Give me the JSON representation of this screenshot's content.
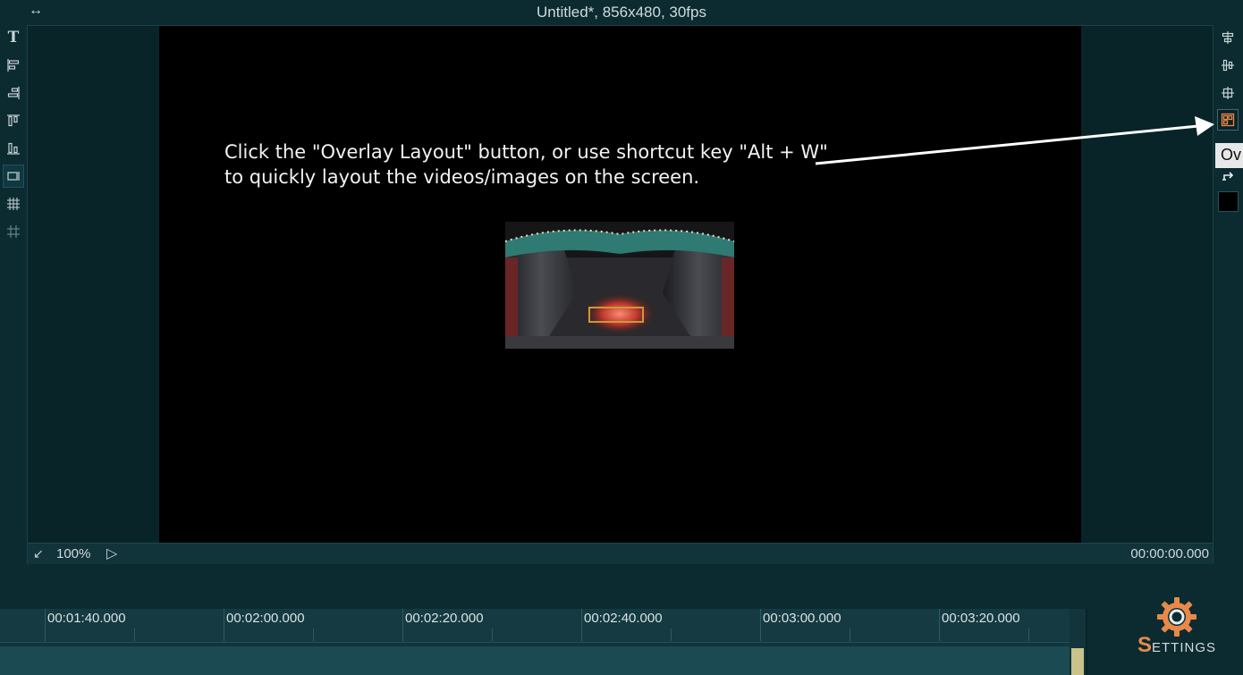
{
  "window": {
    "title": "Untitled*, 856x480, 30fps",
    "swap_icon": "↔"
  },
  "left_toolbar": [
    {
      "name": "text-tool",
      "icon": "T"
    },
    {
      "name": "align-left",
      "icon": "align-left-icon"
    },
    {
      "name": "align-right",
      "icon": "align-right-icon"
    },
    {
      "name": "align-top",
      "icon": "align-top-icon"
    },
    {
      "name": "align-bottom",
      "icon": "align-bottom-icon"
    },
    {
      "name": "safe-frame",
      "icon": "frame-icon"
    },
    {
      "name": "grid-dense",
      "icon": "grid-icon"
    },
    {
      "name": "grid",
      "icon": "hash-icon"
    }
  ],
  "preview": {
    "hint_line1": "Click the \"Overlay Layout\" button, or use shortcut key \"Alt + W\"",
    "hint_line2": "to quickly layout the videos/images on the screen.",
    "zoom": "100%",
    "timecode": "00:00:00.000",
    "shrink_icon": "↙",
    "play_icon": "▷",
    "overlay_image": "stage-curtain-thumbnail"
  },
  "right_toolbar": {
    "tooltip": "Ov",
    "active_tool": "overlay-layout",
    "active_color": "#e8894a",
    "swatch_color": "#000000"
  },
  "timeline": {
    "labels": [
      "00:01:40.000",
      "00:02:00.000",
      "00:02:20.000",
      "00:02:40.000",
      "00:03:00.000",
      "00:03:20.000"
    ]
  },
  "settings": {
    "first_letter": "S",
    "rest": "ETTINGS"
  }
}
